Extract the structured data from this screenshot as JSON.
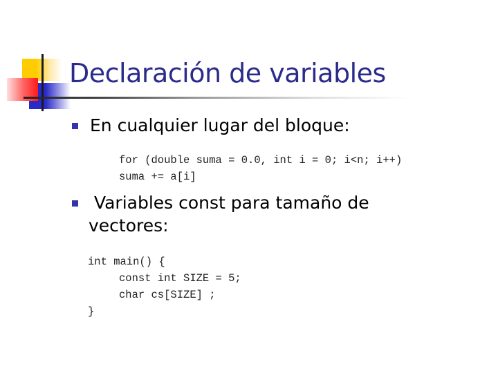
{
  "slide": {
    "title": "Declaración de variables",
    "bullets": [
      {
        "text": "En cualquier lugar del bloque:",
        "code": [
          "for (double suma = 0.0, int i = 0; i<n; i++)",
          "suma += a[i]"
        ]
      },
      {
        "text_line1": " Variables const para tamaño de",
        "text_line2": "vectores:",
        "code": [
          "int main() {",
          "const int SIZE = 5;",
          "char cs[SIZE] ;",
          "}"
        ]
      }
    ],
    "colors": {
      "title": "#2b2b8c",
      "bullet": "#3333aa",
      "deco_yellow": "#ffcc00",
      "deco_blue": "#2a2ac8",
      "deco_red": "#ff1a1a"
    },
    "bullet_icon": "square-bullet"
  }
}
